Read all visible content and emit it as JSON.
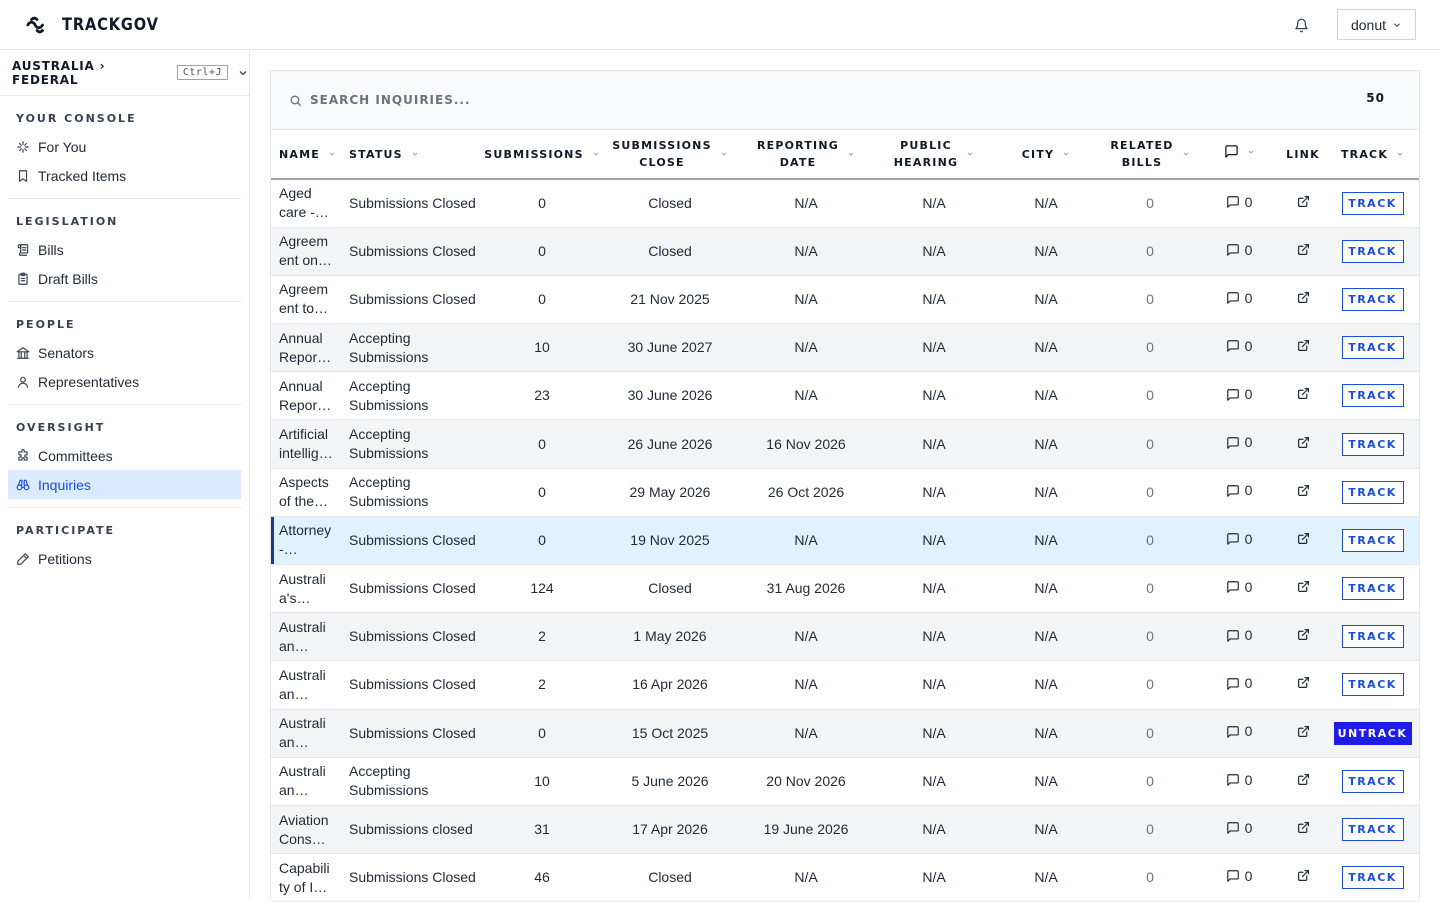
{
  "app": {
    "name": "TRACKGOV"
  },
  "user": {
    "name": "donut"
  },
  "jurisdiction": {
    "label": "AUSTRALIA › FEDERAL",
    "shortcut": "Ctrl+J"
  },
  "sidebar": {
    "sections": [
      {
        "title": "YOUR CONSOLE",
        "items": [
          {
            "label": "For You",
            "icon": "sparkle-icon"
          },
          {
            "label": "Tracked Items",
            "icon": "bookmark-icon"
          }
        ]
      },
      {
        "title": "LEGISLATION",
        "items": [
          {
            "label": "Bills",
            "icon": "scroll-icon"
          },
          {
            "label": "Draft Bills",
            "icon": "clipboard-icon"
          }
        ]
      },
      {
        "title": "PEOPLE",
        "items": [
          {
            "label": "Senators",
            "icon": "landmark-icon"
          },
          {
            "label": "Representatives",
            "icon": "person-icon"
          }
        ]
      },
      {
        "title": "OVERSIGHT",
        "items": [
          {
            "label": "Committees",
            "icon": "puzzle-icon"
          },
          {
            "label": "Inquiries",
            "icon": "binoculars-icon",
            "active": true
          }
        ]
      },
      {
        "title": "PARTICIPATE",
        "items": [
          {
            "label": "Petitions",
            "icon": "pen-icon"
          }
        ]
      }
    ]
  },
  "search": {
    "placeholder": "SEARCH INQUIRIES...",
    "count": "50"
  },
  "table": {
    "columns": {
      "name": "NAME",
      "status": "STATUS",
      "submissions": "SUBMISSIONS",
      "close_1": "SUBMISSIONS",
      "close_2": "CLOSE",
      "reporting_1": "REPORTING",
      "reporting_2": "DATE",
      "hearing_1": "PUBLIC",
      "hearing_2": "HEARING",
      "city": "CITY",
      "related_1": "RELATED",
      "related_2": "BILLS",
      "link": "LINK",
      "track": "TRACK"
    },
    "rows": [
      {
        "name": [
          "Aged",
          "care -…"
        ],
        "status": [
          "Submissions Closed"
        ],
        "submissions": "0",
        "close": "Closed",
        "reporting": "N/A",
        "hearing": "N/A",
        "city": "N/A",
        "related": "0",
        "comments": "0",
        "track": "TRACK"
      },
      {
        "name": [
          "Agreem",
          "ent on…"
        ],
        "status": [
          "Submissions Closed"
        ],
        "submissions": "0",
        "close": "Closed",
        "reporting": "N/A",
        "hearing": "N/A",
        "city": "N/A",
        "related": "0",
        "comments": "0",
        "track": "TRACK"
      },
      {
        "name": [
          "Agreem",
          "ent to…"
        ],
        "status": [
          "Submissions Closed"
        ],
        "submissions": "0",
        "close": "21 Nov 2025",
        "reporting": "N/A",
        "hearing": "N/A",
        "city": "N/A",
        "related": "0",
        "comments": "0",
        "track": "TRACK"
      },
      {
        "name": [
          "Annual",
          "Repor…"
        ],
        "status": [
          "Accepting",
          "Submissions"
        ],
        "submissions": "10",
        "close": "30 June 2027",
        "reporting": "N/A",
        "hearing": "N/A",
        "city": "N/A",
        "related": "0",
        "comments": "0",
        "track": "TRACK"
      },
      {
        "name": [
          "Annual",
          "Repor…"
        ],
        "status": [
          "Accepting",
          "Submissions"
        ],
        "submissions": "23",
        "close": "30 June 2026",
        "reporting": "N/A",
        "hearing": "N/A",
        "city": "N/A",
        "related": "0",
        "comments": "0",
        "track": "TRACK"
      },
      {
        "name": [
          "Artificial",
          "intellig…"
        ],
        "status": [
          "Accepting",
          "Submissions"
        ],
        "submissions": "0",
        "close": "26 June 2026",
        "reporting": "16 Nov 2026",
        "hearing": "N/A",
        "city": "N/A",
        "related": "0",
        "comments": "0",
        "track": "TRACK"
      },
      {
        "name": [
          "Aspects",
          "of the…"
        ],
        "status": [
          "Accepting",
          "Submissions"
        ],
        "submissions": "0",
        "close": "29 May 2026",
        "reporting": "26 Oct 2026",
        "hearing": "N/A",
        "city": "N/A",
        "related": "0",
        "comments": "0",
        "track": "TRACK"
      },
      {
        "name": [
          "Attorney",
          "-…"
        ],
        "status": [
          "Submissions Closed"
        ],
        "submissions": "0",
        "close": "19 Nov 2025",
        "reporting": "N/A",
        "hearing": "N/A",
        "city": "N/A",
        "related": "0",
        "comments": "0",
        "track": "TRACK",
        "highlight": true
      },
      {
        "name": [
          "Australi",
          "a's…"
        ],
        "status": [
          "Submissions Closed"
        ],
        "submissions": "124",
        "close": "Closed",
        "reporting": "31 Aug 2026",
        "hearing": "N/A",
        "city": "N/A",
        "related": "0",
        "comments": "0",
        "track": "TRACK"
      },
      {
        "name": [
          "Australi",
          "an…"
        ],
        "status": [
          "Submissions Closed"
        ],
        "submissions": "2",
        "close": "1 May 2026",
        "reporting": "N/A",
        "hearing": "N/A",
        "city": "N/A",
        "related": "0",
        "comments": "0",
        "track": "TRACK"
      },
      {
        "name": [
          "Australi",
          "an…"
        ],
        "status": [
          "Submissions Closed"
        ],
        "submissions": "2",
        "close": "16 Apr 2026",
        "reporting": "N/A",
        "hearing": "N/A",
        "city": "N/A",
        "related": "0",
        "comments": "0",
        "track": "TRACK"
      },
      {
        "name": [
          "Australi",
          "an…"
        ],
        "status": [
          "Submissions Closed"
        ],
        "submissions": "0",
        "close": "15 Oct 2025",
        "reporting": "N/A",
        "hearing": "N/A",
        "city": "N/A",
        "related": "0",
        "comments": "0",
        "track": "UNTRACK",
        "tracked": true
      },
      {
        "name": [
          "Australi",
          "an…"
        ],
        "status": [
          "Accepting",
          "Submissions"
        ],
        "submissions": "10",
        "close": "5 June 2026",
        "reporting": "20 Nov 2026",
        "hearing": "N/A",
        "city": "N/A",
        "related": "0",
        "comments": "0",
        "track": "TRACK"
      },
      {
        "name": [
          "Aviation",
          "Cons…"
        ],
        "status": [
          "Submissions closed"
        ],
        "submissions": "31",
        "close": "17 Apr 2026",
        "reporting": "19 June 2026",
        "hearing": "N/A",
        "city": "N/A",
        "related": "0",
        "comments": "0",
        "track": "TRACK"
      },
      {
        "name": [
          "Capabili",
          "ty of I…"
        ],
        "status": [
          "Submissions Closed"
        ],
        "submissions": "46",
        "close": "Closed",
        "reporting": "N/A",
        "hearing": "N/A",
        "city": "N/A",
        "related": "0",
        "comments": "0",
        "track": "TRACK"
      }
    ]
  },
  "colors": {
    "accent": "#1d4ed8",
    "untrack_bg": "#1d1de6",
    "active_nav_bg": "#dbeafe"
  }
}
